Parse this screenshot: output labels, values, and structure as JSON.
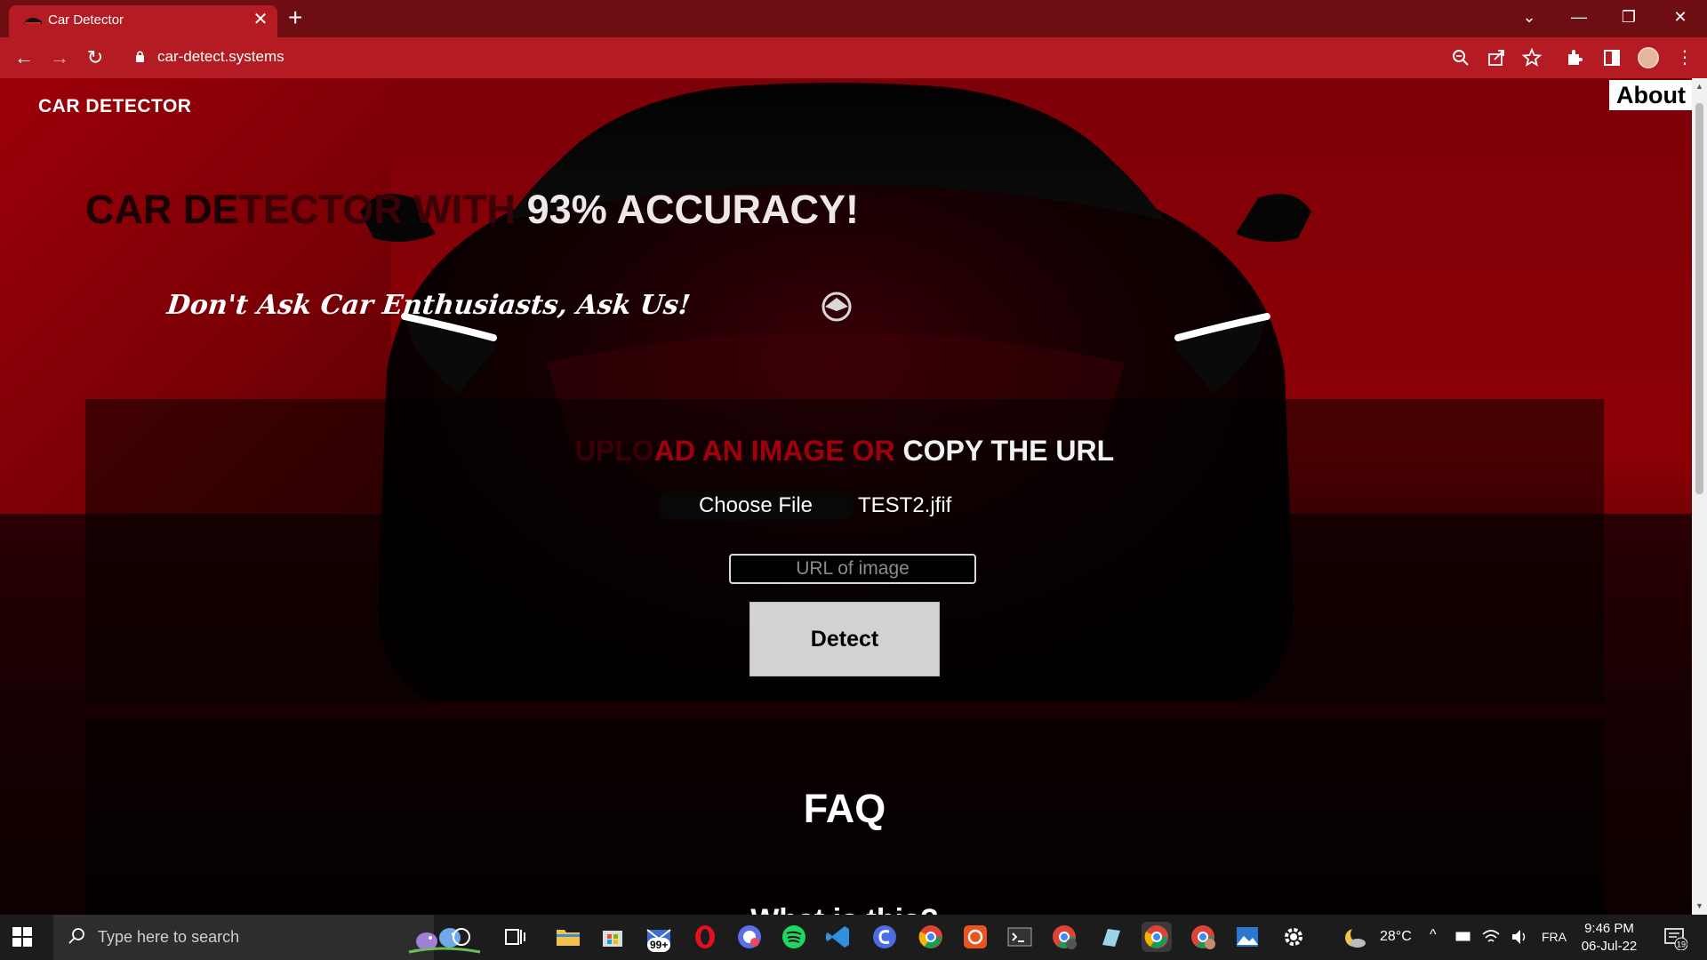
{
  "browser": {
    "tab_title": "Car Detector",
    "tab_close": "✕",
    "new_tab": "+",
    "url": "car-detect.systems"
  },
  "site": {
    "logo_text": "CAR DETECTOR",
    "nav_about": "About",
    "hero_part1": "CAR DE",
    "hero_part2": "TECTOR WITH ",
    "hero_part3": "93% ACCURACY!",
    "tagline": "Don't Ask Car Enthusiasts, Ask Us!",
    "upload_part1": "UPLO",
    "upload_part2": "AD AN IMAGE OR ",
    "upload_part3": "COPY THE URL",
    "choose_file": "Choose File",
    "file_name": "TEST2.jfif",
    "url_placeholder": "URL of image",
    "detect": "Detect",
    "faq_title": "FAQ",
    "faq_question": "What is this?"
  },
  "taskbar": {
    "search_placeholder": "Type here to search",
    "mail_badge": "99+",
    "temperature": "28°C",
    "language": "FRA",
    "time": "9:46 PM",
    "date": "06-Jul-22",
    "notifications": "19"
  }
}
